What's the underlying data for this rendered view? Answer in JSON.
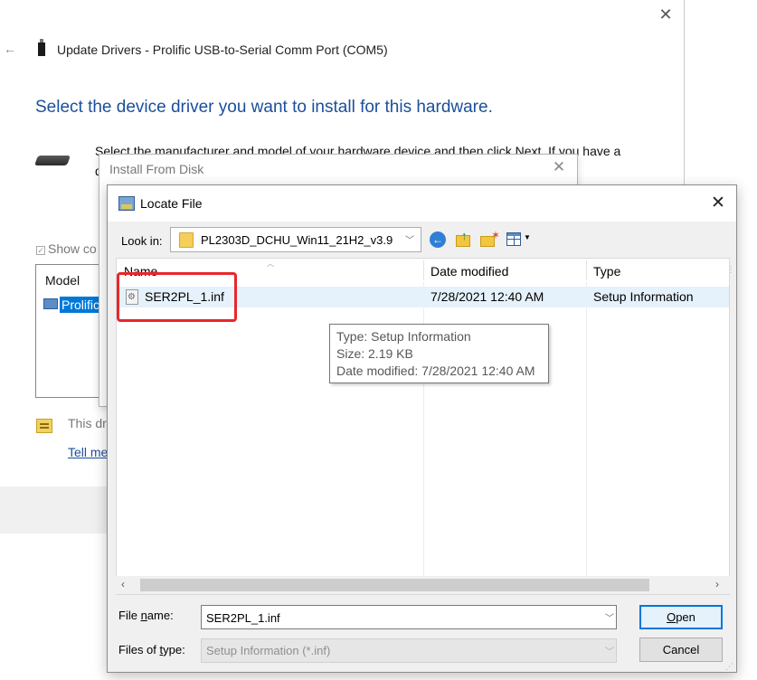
{
  "wizard": {
    "window_title": "Update Drivers - Prolific USB-to-Serial Comm Port (COM5)",
    "heading": "Select the device driver you want to install for this hardware.",
    "description": "Select the manufacturer and model of your hardware device and then click Next. If you have a",
    "description_cont": "d",
    "show_compatible": "Show co",
    "model_header": "Model",
    "model_item": "Prolific",
    "signed_text": "This dr",
    "tell_me_link": "Tell me"
  },
  "install_disk": {
    "title": "Install From Disk"
  },
  "locate": {
    "title": "Locate File",
    "look_in_label": "Look in:",
    "look_in_value": "PL2303D_DCHU_Win11_21H2_v3.9",
    "columns": {
      "name": "Name",
      "date": "Date modified",
      "type": "Type"
    },
    "files": [
      {
        "name": "SER2PL_1.inf",
        "date": "7/28/2021 12:40 AM",
        "type": "Setup Information"
      }
    ],
    "tooltip": {
      "type": "Type: Setup Information",
      "size": "Size: 2.19 KB",
      "date": "Date modified: 7/28/2021 12:40 AM"
    },
    "file_name_label_pre": "File ",
    "file_name_label_acc": "n",
    "file_name_label_post": "ame:",
    "file_name_value": "SER2PL_1.inf",
    "files_of_type_label_pre": "Files of ",
    "files_of_type_label_acc": "t",
    "files_of_type_label_post": "ype:",
    "files_of_type_value": "Setup Information (*.inf)",
    "open_label_acc": "O",
    "open_label_post": "pen",
    "cancel_label": "Cancel"
  },
  "colors": {
    "accent": "#0078d7",
    "heading_blue": "#1a4f9c",
    "highlight_red": "#e8272b",
    "row_select": "#e5f1fb"
  }
}
